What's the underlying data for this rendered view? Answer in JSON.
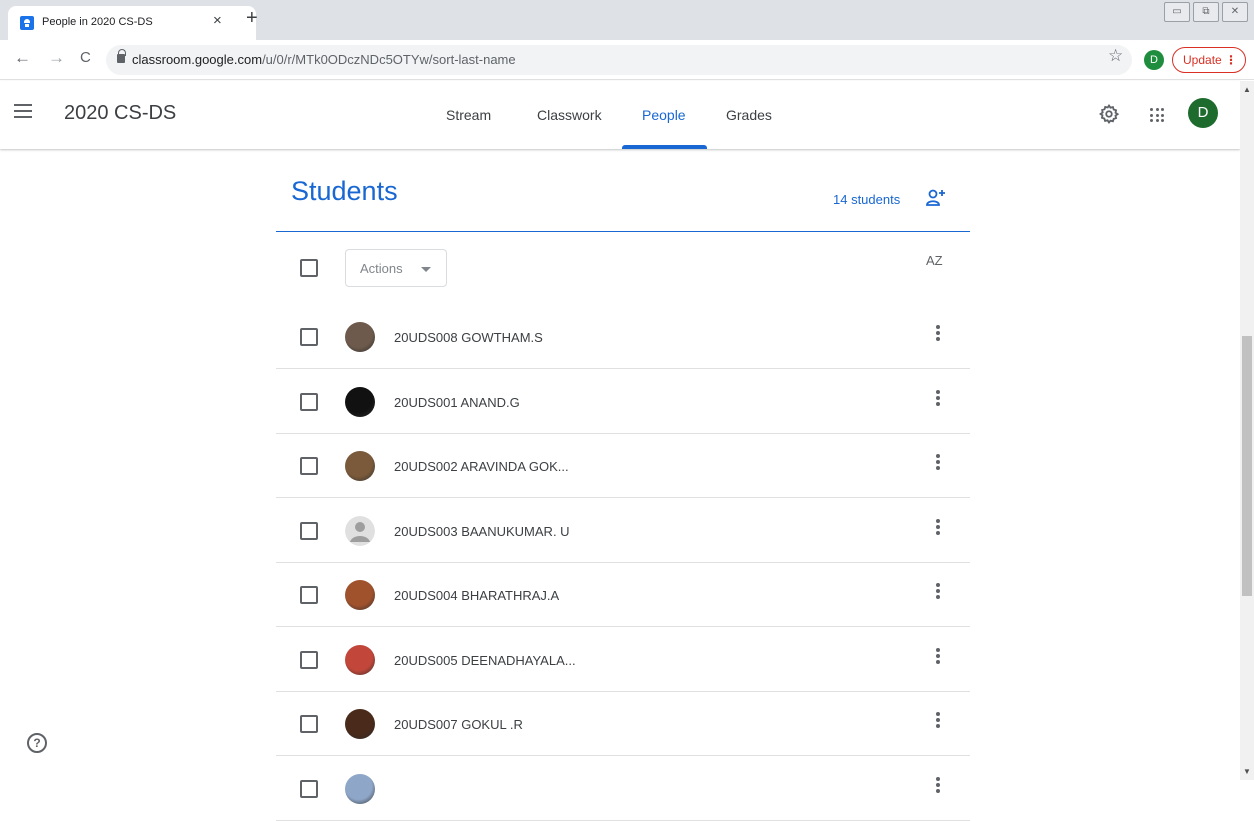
{
  "browser": {
    "tab_title": "People in 2020 CS-DS",
    "tab_close": "×",
    "new_tab": "+",
    "url_host": "classroom.google.com",
    "url_path": "/u/0/r/MTk0ODczNDc5OTYw/sort-last-name",
    "profile_initial": "D",
    "update_label": "Update",
    "update_menu": "⋮",
    "back_glyph": "←",
    "forward_glyph": "→",
    "reload_glyph": "C",
    "star_glyph": "☆",
    "window_min": "▭",
    "window_restore": "⧉",
    "window_close": "✕"
  },
  "header": {
    "class_title": "2020 CS-DS",
    "tabs": [
      {
        "label": "Stream"
      },
      {
        "label": "Classwork"
      },
      {
        "label": "People",
        "active": true
      },
      {
        "label": "Grades"
      }
    ],
    "avatar_initial": "D"
  },
  "students": {
    "title": "Students",
    "count_label": "14 students",
    "actions_label": "Actions",
    "sort_label": "AZ",
    "list": [
      {
        "name": "20UDS008 GOWTHAM.S",
        "avatar": "photo",
        "color": "#6d5a4c"
      },
      {
        "name": "20UDS001 ANAND.G",
        "avatar": "photo",
        "color": "#111111"
      },
      {
        "name": "20UDS002 ARAVINDA GOK...",
        "avatar": "photo",
        "color": "#7a5a3a"
      },
      {
        "name": "20UDS003 BAANUKUMAR. U",
        "avatar": "default",
        "color": "#bdbdbd"
      },
      {
        "name": "20UDS004 BHARATHRAJ.A",
        "avatar": "photo",
        "color": "#a0522d"
      },
      {
        "name": "20UDS005 DEENADHAYALA...",
        "avatar": "photo",
        "color": "#c2473a"
      },
      {
        "name": "20UDS007 GOKUL .R",
        "avatar": "photo",
        "color": "#4a2a1a"
      },
      {
        "name": "",
        "avatar": "photo",
        "color": "#8ea6c8"
      }
    ]
  },
  "help": {
    "glyph": "?"
  },
  "colors": {
    "accent": "#1967d2",
    "update_red": "#d93025",
    "avatar_green": "#1e6b2e"
  }
}
